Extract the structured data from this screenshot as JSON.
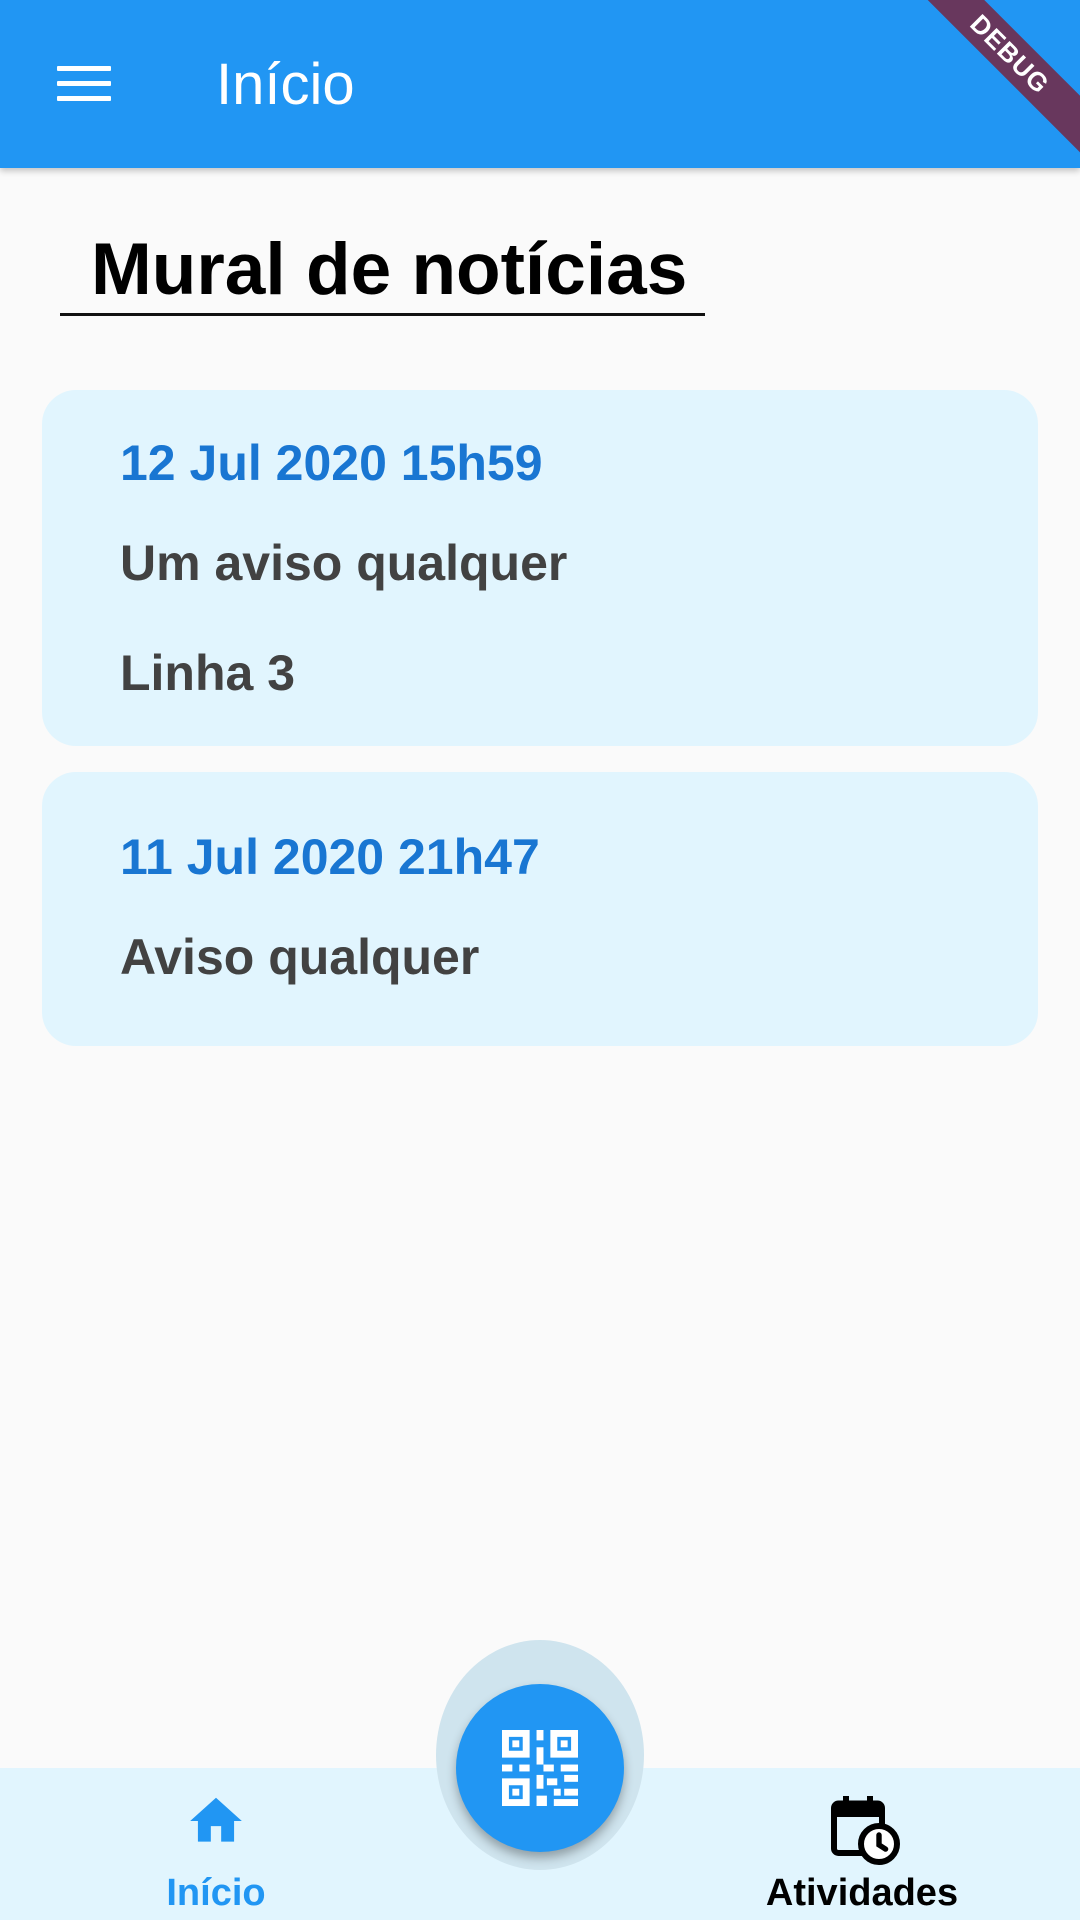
{
  "app_bar": {
    "title": "Início",
    "menu_icon": "menu-icon",
    "debug_banner": "DEBUG",
    "color": "#2196f3"
  },
  "section": {
    "title": "Mural de notícias"
  },
  "notices": [
    {
      "date": "12 Jul 2020 15h59",
      "lines": [
        "Um aviso qualquer",
        "Linha 3"
      ]
    },
    {
      "date": "11 Jul 2020 21h47",
      "lines": [
        "Aviso qualquer"
      ]
    }
  ],
  "bottom_nav": {
    "items": [
      {
        "label": "Início",
        "icon": "home-icon",
        "active": true,
        "color": "#2196f3"
      },
      {
        "label": "Atividades",
        "icon": "calendar-clock-icon",
        "active": false,
        "color": "#000000"
      }
    ],
    "fab_icon": "qr-code-icon"
  },
  "colors": {
    "card_background": "#e1f5fe",
    "date_text": "#1976d2",
    "body_text": "#424242"
  }
}
